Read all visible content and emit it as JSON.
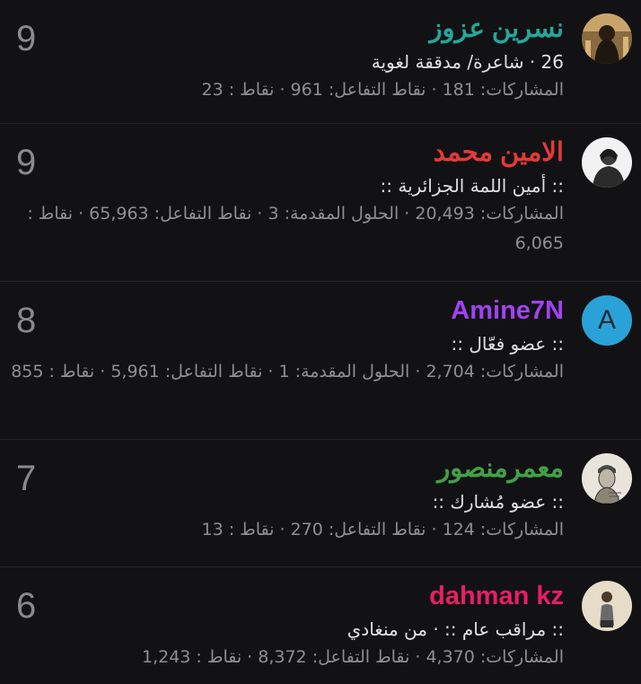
{
  "members": [
    {
      "name": "نسرين عزوز",
      "name_color": "#26a69a",
      "title": "26 · شاعرة/ مدققة لغوية",
      "stats": "المشاركات: 181 · نقاط التفاعل: 961 · نقاط : 23",
      "score": "9",
      "avatar": "photo-woman-portrait"
    },
    {
      "name": "الامين محمد",
      "name_color": "#e53935",
      "title": ":: أمين اللمة الجزائرية ::",
      "stats": "المشاركات: 20,493 · الحلول المقدمة: 3 · نقاط التفاعل: 65,963 · نقاط : 6,065",
      "score": "9",
      "avatar": "photo-man-hoodie"
    },
    {
      "name": "Amine7N",
      "name_color": "#a142f4",
      "title": ":: عضو فعّال ::",
      "stats": "المشاركات: 2,704 · الحلول المقدمة: 1 · نقاط التفاعل: 5,961 · نقاط : 855",
      "score": "8",
      "avatar": "letter-avatar",
      "avatar_letter": "A"
    },
    {
      "name": "معمرمنصور",
      "name_color": "#43a047",
      "title": ":: عضو مُشارك ::",
      "stats": "المشاركات: 124 · نقاط التفاعل: 270 · نقاط : 13",
      "score": "7",
      "avatar": "sketch-portrait"
    },
    {
      "name": "dahman kz",
      "name_color": "#e91e63",
      "title": ":: مراقب عام :: · من منغادي",
      "stats": "المشاركات: 4,370 · نقاط التفاعل: 8,372 · نقاط : 1,243",
      "score": "6",
      "avatar": "photo-figure"
    }
  ]
}
